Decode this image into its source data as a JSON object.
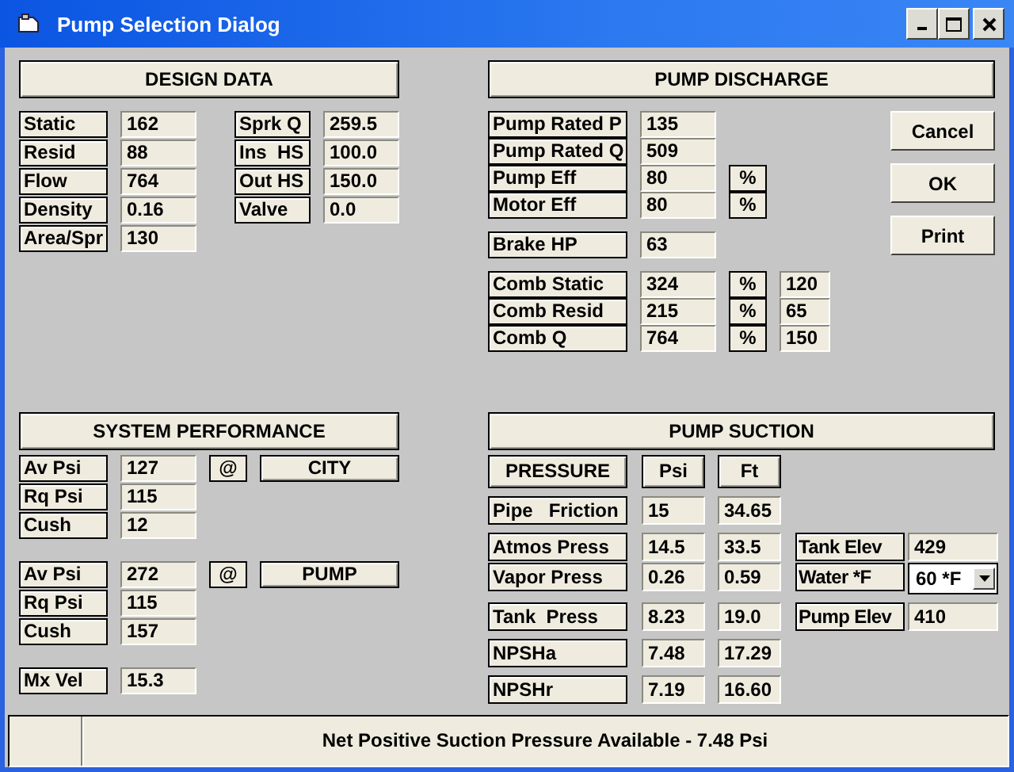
{
  "window": {
    "title": "Pump Selection Dialog"
  },
  "sections": [
    {
      "kind": "design",
      "title": "DESIGN DATA",
      "groups": [
        [
          [
            {
              "kind": "label",
              "text": "Static"
            },
            {
              "kind": "value",
              "text": "162"
            },
            {
              "kind": "label",
              "text": "Sprk Q"
            },
            {
              "kind": "value",
              "text": "259.5"
            }
          ],
          [
            {
              "kind": "label",
              "text": "Resid"
            },
            {
              "kind": "value",
              "text": "88"
            },
            {
              "kind": "label",
              "text": "Ins  HS"
            },
            {
              "kind": "value",
              "text": "100.0"
            }
          ],
          [
            {
              "kind": "label",
              "text": "Flow"
            },
            {
              "kind": "value",
              "text": "764"
            },
            {
              "kind": "label",
              "text": "Out HS"
            },
            {
              "kind": "value",
              "text": "150.0"
            }
          ],
          [
            {
              "kind": "label",
              "text": "Density"
            },
            {
              "kind": "value",
              "text": "0.16"
            },
            {
              "kind": "label",
              "text": "Valve"
            },
            {
              "kind": "value",
              "text": "0.0"
            }
          ],
          [
            {
              "kind": "label",
              "text": "Area/Spr"
            },
            {
              "kind": "value",
              "text": "130"
            }
          ]
        ]
      ]
    },
    {
      "kind": "discharge",
      "title": "PUMP DISCHARGE",
      "groups": [
        [
          [
            {
              "kind": "label",
              "text": "Pump Rated P"
            },
            {
              "kind": "value",
              "text": "135"
            }
          ],
          [
            {
              "kind": "label",
              "text": "Pump Rated Q"
            },
            {
              "kind": "value",
              "text": "509"
            }
          ],
          [
            {
              "kind": "label",
              "text": "Pump Eff"
            },
            {
              "kind": "value",
              "text": "80"
            },
            {
              "kind": "unit",
              "text": "%"
            }
          ],
          [
            {
              "kind": "label",
              "text": "Motor Eff"
            },
            {
              "kind": "value",
              "text": "80"
            },
            {
              "kind": "unit",
              "text": "%"
            }
          ]
        ],
        [
          [
            {
              "kind": "label",
              "text": "Brake HP"
            },
            {
              "kind": "value",
              "text": "63"
            }
          ]
        ],
        [
          [
            {
              "kind": "label",
              "text": "Comb Static"
            },
            {
              "kind": "value",
              "text": "324"
            },
            {
              "kind": "unit",
              "text": "%"
            },
            {
              "kind": "value",
              "text": "120"
            }
          ],
          [
            {
              "kind": "label",
              "text": "Comb Resid"
            },
            {
              "kind": "value",
              "text": "215"
            },
            {
              "kind": "unit",
              "text": "%"
            },
            {
              "kind": "value",
              "text": "65"
            }
          ],
          [
            {
              "kind": "label",
              "text": "Comb Q"
            },
            {
              "kind": "value",
              "text": "764"
            },
            {
              "kind": "unit",
              "text": "%"
            },
            {
              "kind": "value",
              "text": "150"
            }
          ]
        ]
      ],
      "buttons": [
        "Cancel",
        "OK",
        "Print"
      ]
    },
    {
      "kind": "system",
      "title": "SYSTEM PERFORMANCE",
      "groups": [
        [
          [
            {
              "kind": "label",
              "text": "Av Psi"
            },
            {
              "kind": "value",
              "text": "127"
            },
            {
              "kind": "unit",
              "text": "@"
            },
            {
              "kind": "head",
              "text": "CITY"
            }
          ],
          [
            {
              "kind": "label",
              "text": "Rq Psi"
            },
            {
              "kind": "value",
              "text": "115"
            }
          ],
          [
            {
              "kind": "label",
              "text": "Cush"
            },
            {
              "kind": "value",
              "text": "12"
            }
          ]
        ],
        [
          [
            {
              "kind": "label",
              "text": "Av Psi"
            },
            {
              "kind": "value",
              "text": "272"
            },
            {
              "kind": "unit",
              "text": "@"
            },
            {
              "kind": "head",
              "text": "PUMP"
            }
          ],
          [
            {
              "kind": "label",
              "text": "Rq Psi"
            },
            {
              "kind": "value",
              "text": "115"
            }
          ],
          [
            {
              "kind": "label",
              "text": "Cush"
            },
            {
              "kind": "value",
              "text": "157"
            }
          ]
        ],
        [
          [
            {
              "kind": "label",
              "text": "Mx Vel"
            },
            {
              "kind": "value",
              "text": "15.3"
            }
          ]
        ]
      ]
    },
    {
      "kind": "suction",
      "title": "PUMP SUCTION",
      "groups": [
        [
          [
            {
              "kind": "head",
              "text": "PRESSURE"
            },
            {
              "kind": "head",
              "text": "Psi"
            },
            {
              "kind": "head",
              "text": "Ft"
            }
          ]
        ],
        [
          [
            {
              "kind": "label",
              "text": "Pipe   Friction"
            },
            {
              "kind": "value",
              "text": "15"
            },
            {
              "kind": "value",
              "text": "34.65"
            }
          ]
        ],
        [
          [
            {
              "kind": "label",
              "text": "Atmos Press"
            },
            {
              "kind": "value",
              "text": "14.5"
            },
            {
              "kind": "value",
              "text": "33.5"
            },
            {
              "kind": "label",
              "text": "Tank Elev"
            },
            {
              "kind": "value",
              "text": "429"
            }
          ],
          [
            {
              "kind": "label",
              "text": "Vapor Press"
            },
            {
              "kind": "value",
              "text": "0.26"
            },
            {
              "kind": "value",
              "text": "0.59"
            },
            {
              "kind": "label",
              "text": "Water *F"
            },
            {
              "kind": "combo",
              "text": "60 *F"
            }
          ]
        ],
        [
          [
            {
              "kind": "label",
              "text": "Tank  Press"
            },
            {
              "kind": "value",
              "text": "8.23"
            },
            {
              "kind": "value",
              "text": "19.0"
            },
            {
              "kind": "label",
              "text": "Pump Elev"
            },
            {
              "kind": "value",
              "text": "410"
            }
          ]
        ],
        [
          [
            {
              "kind": "label",
              "text": "NPSHa"
            },
            {
              "kind": "value",
              "text": "7.48"
            },
            {
              "kind": "value",
              "text": "17.29"
            }
          ]
        ],
        [
          [
            {
              "kind": "label",
              "text": "NPSHr"
            },
            {
              "kind": "value",
              "text": "7.19"
            },
            {
              "kind": "value",
              "text": "16.60"
            }
          ]
        ]
      ]
    }
  ],
  "status_bar": {
    "text": "Net Positive Suction Pressure Available - 7.48 Psi"
  }
}
